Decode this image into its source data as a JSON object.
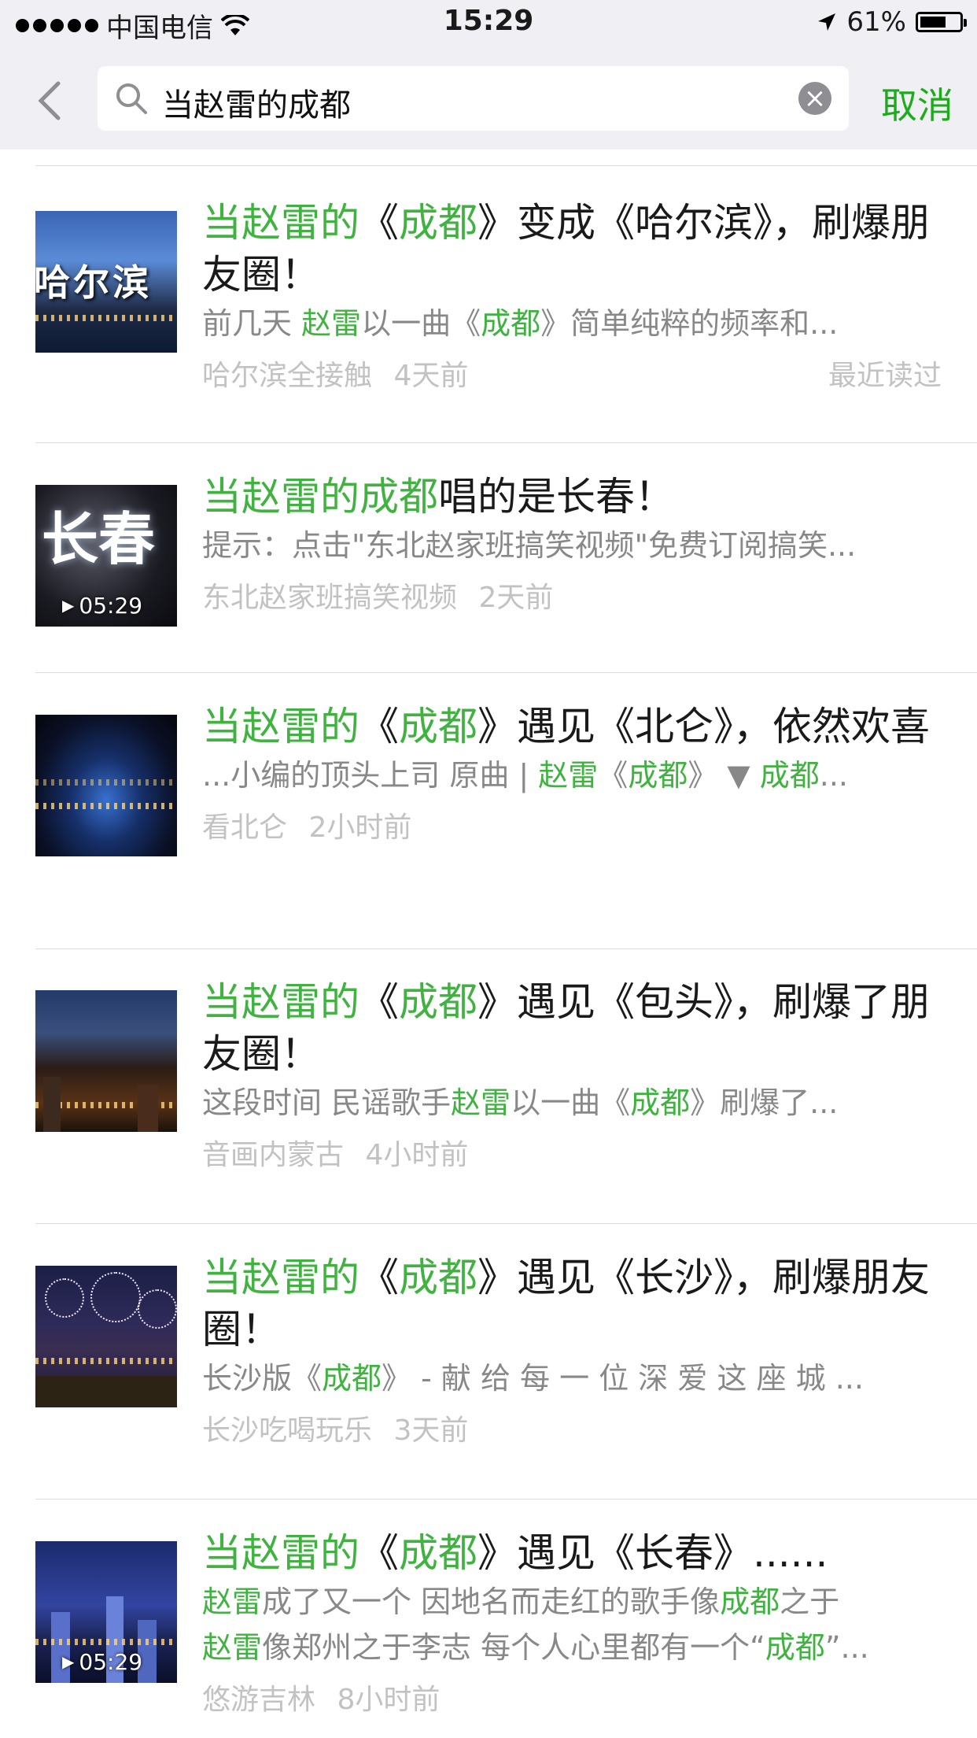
{
  "status": {
    "carrier": "中国电信",
    "time": "15:29",
    "battery": "61%"
  },
  "search": {
    "query": "当赵雷的成都",
    "cancel": "取消",
    "clear": "×"
  },
  "results": [
    {
      "title": [
        {
          "t": "当赵雷的",
          "h": true
        },
        {
          "t": "《",
          "h": false
        },
        {
          "t": "成都",
          "h": true
        },
        {
          "t": "》变成《哈尔滨》，刷爆朋友圈！",
          "h": false
        }
      ],
      "desc": [
        {
          "t": "前几天 ",
          "h": false
        },
        {
          "t": "赵雷",
          "h": true
        },
        {
          "t": "以一曲《",
          "h": false
        },
        {
          "t": "成都",
          "h": true
        },
        {
          "t": "》简单纯粹的频率和...",
          "h": false
        }
      ],
      "source": "哈尔滨全接触",
      "time": "4天前",
      "recent": "最近读过",
      "thumb_text": "哈尔滨"
    },
    {
      "title": [
        {
          "t": "当赵雷的成都",
          "h": true
        },
        {
          "t": "唱的是长春！",
          "h": false
        }
      ],
      "desc": [
        {
          "t": "提示：点击\"东北赵家班搞笑视频\"免费订阅搞笑...",
          "h": false
        }
      ],
      "source": "东北赵家班搞笑视频",
      "time": "2天前",
      "duration": "05:29",
      "thumb_text": "长春"
    },
    {
      "title": [
        {
          "t": "当赵雷的",
          "h": true
        },
        {
          "t": "《",
          "h": false
        },
        {
          "t": "成都",
          "h": true
        },
        {
          "t": "》遇见《北仑》，依然欢喜",
          "h": false
        }
      ],
      "desc": [
        {
          "t": "...小编的顶头上司 原曲 | ",
          "h": false
        },
        {
          "t": "赵雷",
          "h": true
        },
        {
          "t": "《",
          "h": false
        },
        {
          "t": "成都",
          "h": true
        },
        {
          "t": "》 ▼ ",
          "h": false
        },
        {
          "t": "成都",
          "h": true
        },
        {
          "t": "...",
          "h": false
        }
      ],
      "source": "看北仑",
      "time": "2小时前"
    },
    {
      "title": [
        {
          "t": "当赵雷的",
          "h": true
        },
        {
          "t": "《",
          "h": false
        },
        {
          "t": "成都",
          "h": true
        },
        {
          "t": "》遇见《包头》，刷爆了朋友圈！",
          "h": false
        }
      ],
      "desc": [
        {
          "t": "这段时间 民谣歌手",
          "h": false
        },
        {
          "t": "赵雷",
          "h": true
        },
        {
          "t": "以一曲《",
          "h": false
        },
        {
          "t": "成都",
          "h": true
        },
        {
          "t": "》刷爆了...",
          "h": false
        }
      ],
      "source": "音画内蒙古",
      "time": "4小时前"
    },
    {
      "title": [
        {
          "t": "当赵雷的",
          "h": true
        },
        {
          "t": "《",
          "h": false
        },
        {
          "t": "成都",
          "h": true
        },
        {
          "t": "》遇见《长沙》，刷爆朋友圈！",
          "h": false
        }
      ],
      "desc": [
        {
          "t": "长沙版《",
          "h": false
        },
        {
          "t": "成都",
          "h": true
        },
        {
          "t": "》 - 献 给 每 一 位 深 爱 这 座 城 ...",
          "h": false
        }
      ],
      "source": "长沙吃喝玩乐",
      "time": "3天前"
    },
    {
      "title": [
        {
          "t": "当赵雷的",
          "h": true
        },
        {
          "t": "《",
          "h": false
        },
        {
          "t": "成都",
          "h": true
        },
        {
          "t": "》遇见《长春》......",
          "h": false
        }
      ],
      "desc": [
        {
          "t": "赵雷",
          "h": true
        },
        {
          "t": "成了又一个 因地名而走红的歌手像",
          "h": false
        },
        {
          "t": "成都",
          "h": true
        },
        {
          "t": "之于",
          "h": false
        }
      ],
      "desc2": [
        {
          "t": "赵雷",
          "h": true
        },
        {
          "t": "像郑州之于李志 每个人心里都有一个“",
          "h": false
        },
        {
          "t": "成都",
          "h": true
        },
        {
          "t": "”...",
          "h": false
        }
      ],
      "source": "悠游吉林",
      "time": "8小时前",
      "duration": "05:29"
    }
  ]
}
